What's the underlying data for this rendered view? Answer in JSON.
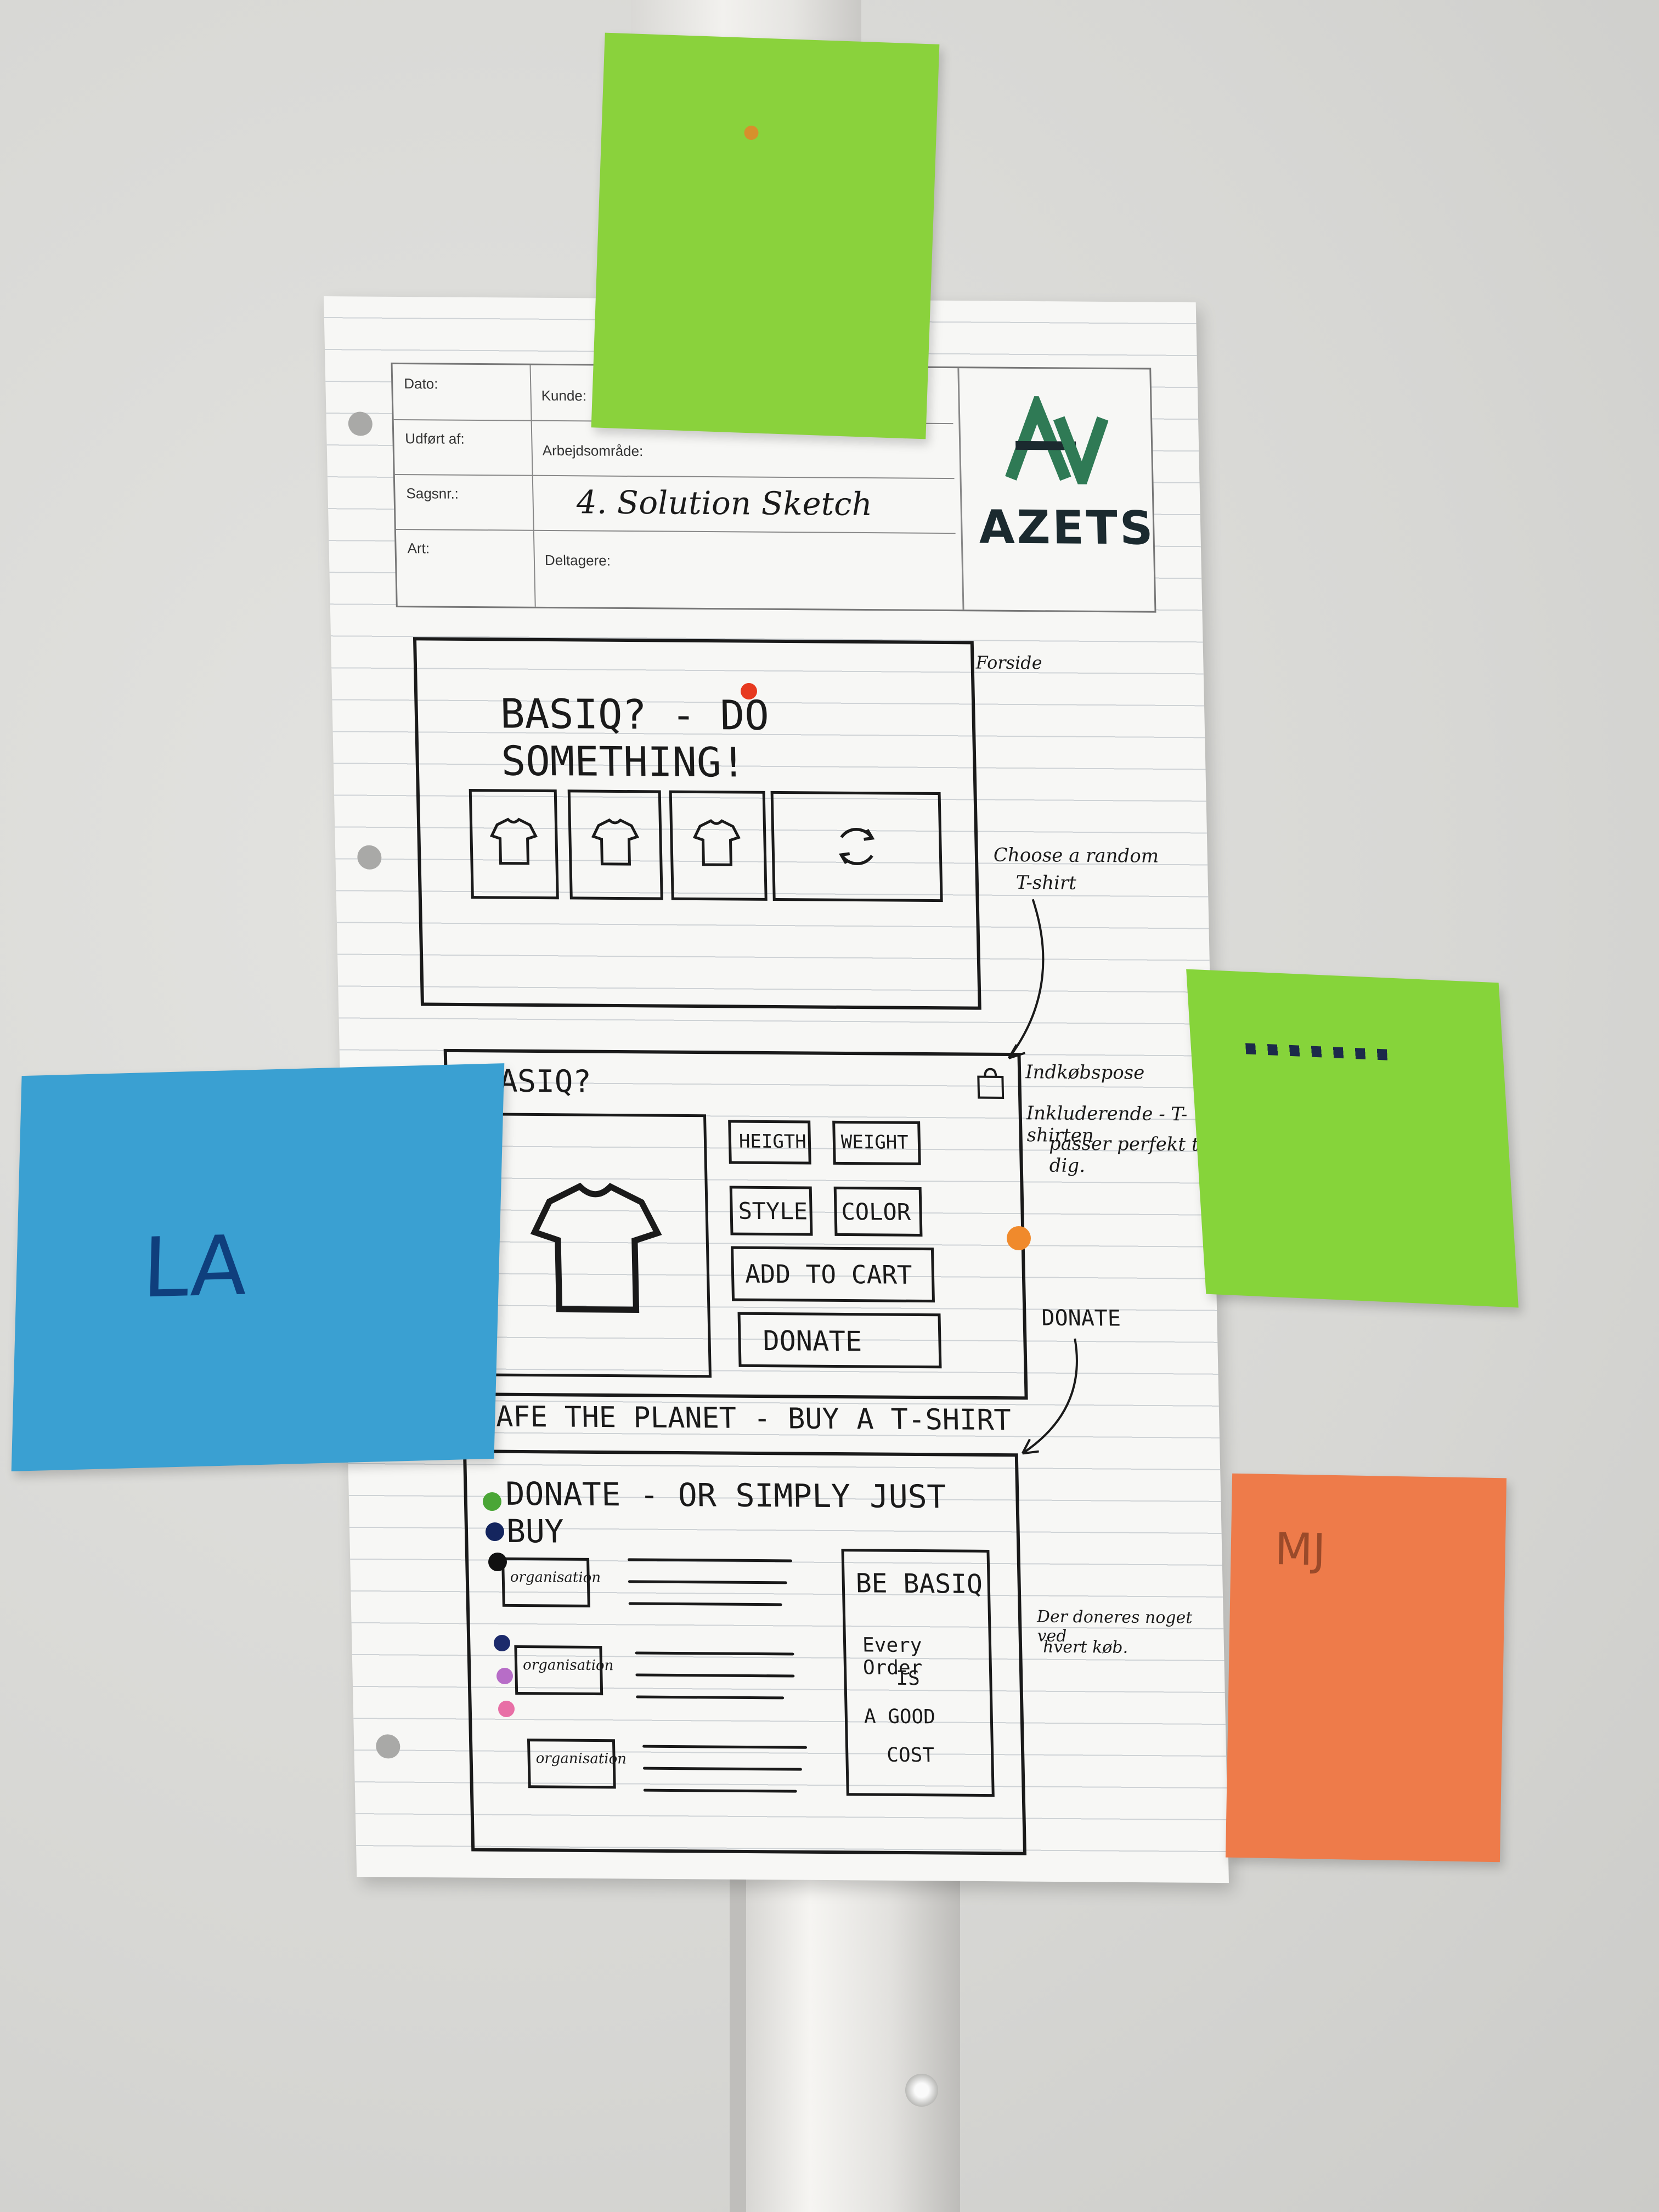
{
  "form": {
    "label_dato": "Dato:",
    "label_kunde": "Kunde:",
    "label_udfort": "Udført af:",
    "label_arbejdsomrade": "Arbejdsområde:",
    "label_sagsnr": "Sagsnr.:",
    "label_art": "Art:",
    "label_deltagere": "Deltagere:",
    "title_handwritten": "4. Solution Sketch",
    "logo_text": "AZETS"
  },
  "panel1": {
    "heading": "BASIQ? - DO SOMETHING!",
    "side_label": "Forside",
    "annotation_line1": "Choose a random",
    "annotation_line2": "T-shirt"
  },
  "panel2": {
    "heading": "BASIQ?",
    "buttons": [
      "HEIGTH",
      "WEIGHT",
      "STYLE",
      "COLOR",
      "ADD TO CART",
      "DONATE"
    ],
    "footer": "SAFE THE PLANET - BUY A T-SHIRT",
    "annotation_1": "Indkøbspose",
    "annotation_2_line1": "Inkluderende - T-shirten",
    "annotation_2_line2": "passer perfekt til dig.",
    "donate_label": "DONATE"
  },
  "panel3": {
    "heading": "DONATE - OR SIMPLY JUST BUY",
    "organisations": [
      "organisation",
      "organisation",
      "organisation"
    ],
    "card_title": "BE BASIQ",
    "card_line1": "Every Order",
    "card_line2": "IS",
    "card_line3": "A GOOD",
    "card_line4": "COST",
    "annotation_line1": "Der doneres noget ved",
    "annotation_line2": "hvert køb."
  },
  "stickies": {
    "blue": "LA",
    "orange": "MJ"
  }
}
